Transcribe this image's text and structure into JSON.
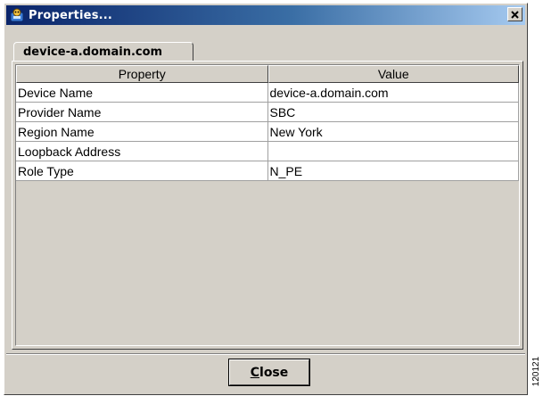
{
  "window": {
    "title": "Properties...",
    "close_icon": "close-x-icon",
    "title_icon": "properties-app-icon",
    "titlebar_colors": [
      "#0a246a",
      "#3a6ea5",
      "#a6caf0"
    ]
  },
  "tab": {
    "label": "device-a.domain.com"
  },
  "table": {
    "columns": [
      "Property",
      "Value"
    ],
    "rows": [
      {
        "property": "Device Name",
        "value": "device-a.domain.com"
      },
      {
        "property": "Provider Name",
        "value": "SBC"
      },
      {
        "property": "Region Name",
        "value": "New York"
      },
      {
        "property": "Loopback Address",
        "value": ""
      },
      {
        "property": "Role Type",
        "value": "N_PE"
      }
    ]
  },
  "footer": {
    "close_label_mnemonic": "C",
    "close_label_rest": "lose"
  },
  "figure_id": "120121"
}
